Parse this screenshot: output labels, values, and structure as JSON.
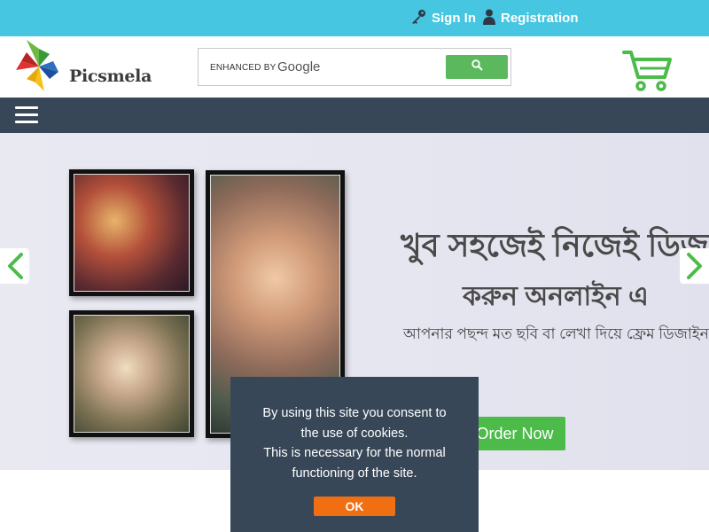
{
  "topbar": {
    "signin_label": "Sign In",
    "register_label": "Registration",
    "background": "#46c6e0"
  },
  "header": {
    "logo_text": "Picsmela",
    "search": {
      "enhanced_by": "ENHANCED BY",
      "provider": "Google",
      "button_icon": "search-icon"
    },
    "cart_icon": "shopping-cart-icon"
  },
  "navbar": {
    "menu_icon": "hamburger-menu-icon",
    "background": "#374758"
  },
  "hero": {
    "headline_line1": "খুব সহজেই নিজেই ডিজাইন",
    "headline_line2": "করুন অনলাইন এ",
    "subline": "আপনার পছন্দ মত ছবি বা লেখা দিয়ে ফ্রেম ডিজাইন করতে পারবেন।",
    "order_label": "Order Now",
    "prev_icon": "chevron-left-icon",
    "next_icon": "chevron-right-icon",
    "accent": "#4cbb4a"
  },
  "cookie_notice": {
    "line1": "By using this site you consent to",
    "line2": "the use of cookies.",
    "line3": "This is necessary for the normal",
    "line4": "functioning of the site.",
    "ok_label": "OK",
    "ok_color": "#f06f13"
  }
}
